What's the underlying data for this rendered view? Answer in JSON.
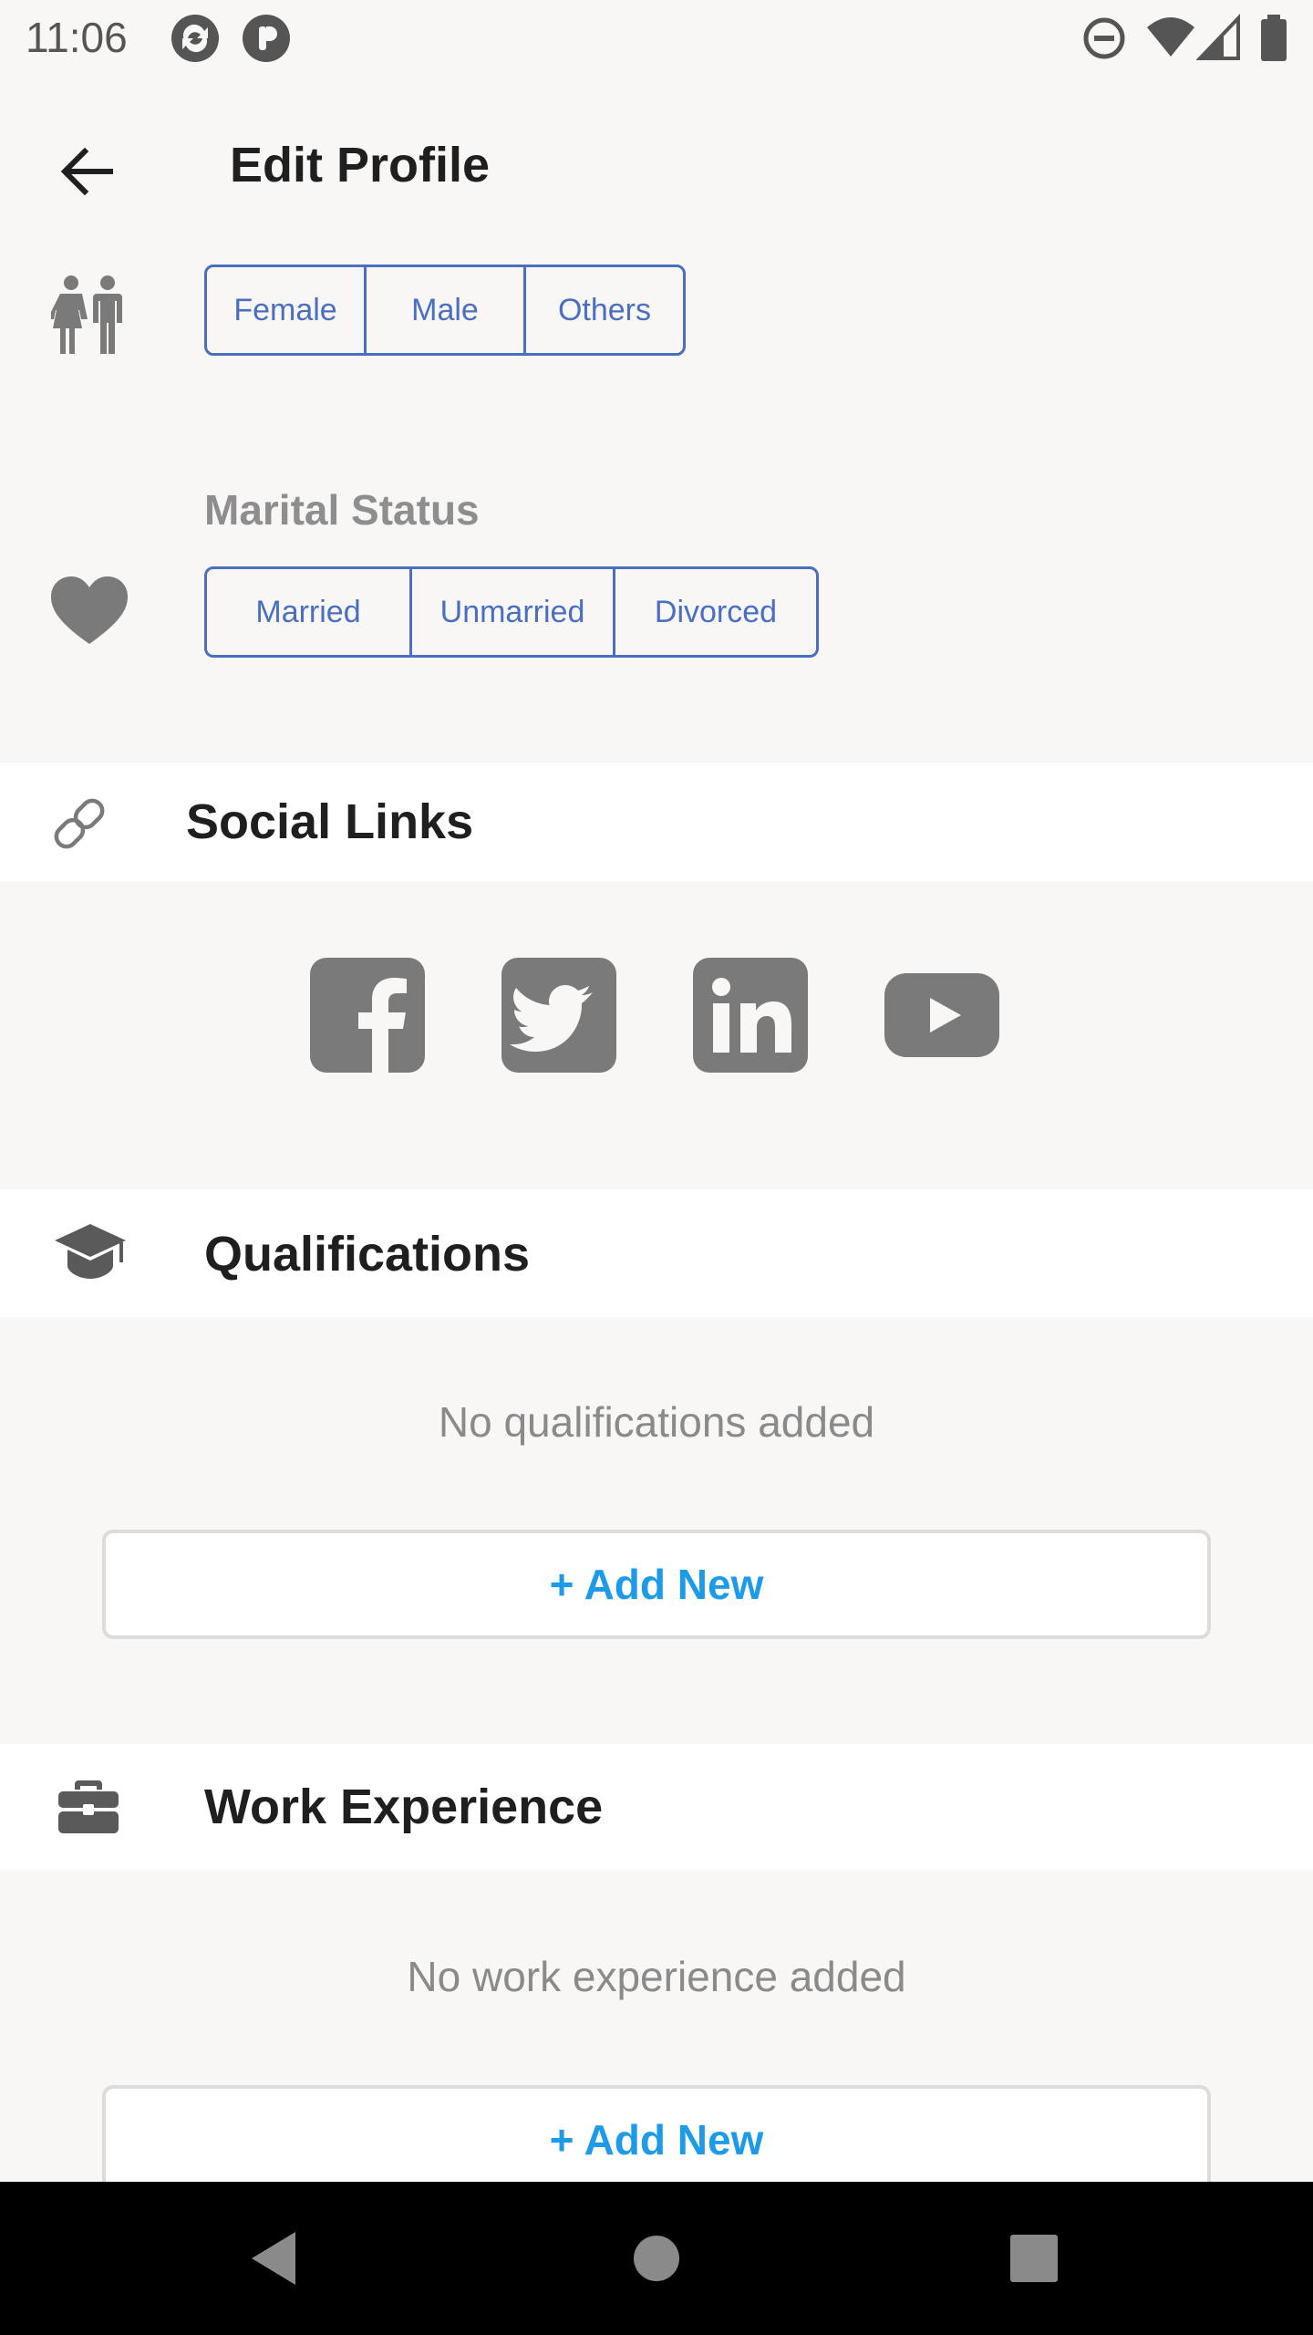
{
  "status_bar": {
    "time": "11:06"
  },
  "app_bar": {
    "title": "Edit Profile"
  },
  "gender": {
    "options": [
      "Female",
      "Male",
      "Others"
    ]
  },
  "marital_status": {
    "label": "Marital Status",
    "options": [
      "Married",
      "Unmarried",
      "Divorced"
    ]
  },
  "social_links": {
    "title": "Social Links",
    "icons": [
      "facebook-icon",
      "twitter-icon",
      "linkedin-icon",
      "youtube-icon"
    ]
  },
  "qualifications": {
    "title": "Qualifications",
    "empty_text": "No qualifications added",
    "add_label": "+ Add New"
  },
  "work_experience": {
    "title": "Work Experience",
    "empty_text": "No work experience added",
    "add_label": "+ Add New"
  },
  "colors": {
    "accent_blue": "#4a6fc1",
    "link_blue": "#1e9be8",
    "icon_gray": "#7a7a7a",
    "background": "#f8f7f5"
  }
}
